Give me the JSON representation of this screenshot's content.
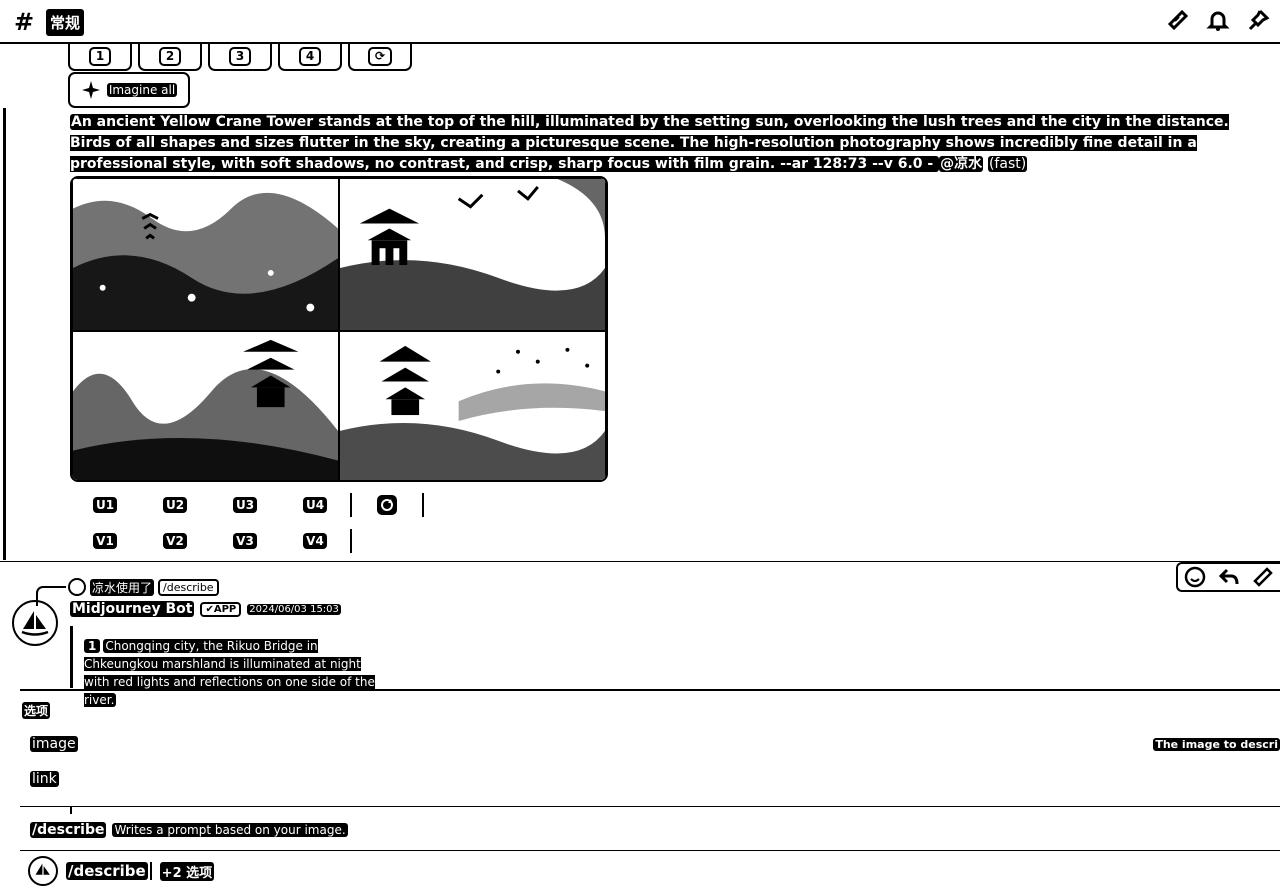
{
  "header": {
    "hash_glyph": "#",
    "channel_name": "常规",
    "icons": [
      "threads-icon",
      "bell-icon",
      "pin-icon"
    ]
  },
  "top_buttons": [
    {
      "label": "1"
    },
    {
      "label": "2"
    },
    {
      "label": "3"
    },
    {
      "label": "4"
    },
    {
      "label": "⟳"
    }
  ],
  "imagine_all_label": "Imagine all",
  "prompt": {
    "text": "An ancient Yellow Crane Tower stands at the top of the hill, illuminated by the setting sun, overlooking the lush trees and the city in the distance. Birds of all shapes and sizes flutter in the sky, creating a picturesque scene. The high-resolution photography shows incredibly fine detail in a professional style, with soft shadows, no contrast, and crisp, sharp focus with film grain. --ar 128:73 --v 6.0 - ",
    "mention": "@凉水",
    "mode": "(fast)"
  },
  "upscale_buttons": [
    "U1",
    "U2",
    "U3",
    "U4"
  ],
  "variation_buttons": [
    "V1",
    "V2",
    "V3",
    "V4"
  ],
  "reply": {
    "user": "凉水使用了",
    "command": "/describe"
  },
  "bot": {
    "name": "Midjourney Bot",
    "badge": "✔APP",
    "timestamp": "2024/06/03 15:03"
  },
  "embed": {
    "number": "1",
    "text": "Chongqing city, the Rikuo Bridge in Chkeungkou marshland is illuminated at night with red lights and reflections on one side of the river."
  },
  "composer": {
    "options_label": "选项",
    "option_image": "image",
    "option_link": "link",
    "option_hint": "The image to descri",
    "command": "/describe",
    "command_desc": "Writes a prompt based on your image.",
    "input_command": "/describe",
    "input_more": "+2 选项"
  },
  "colors": {
    "fg": "#000000",
    "bg": "#ffffff"
  }
}
